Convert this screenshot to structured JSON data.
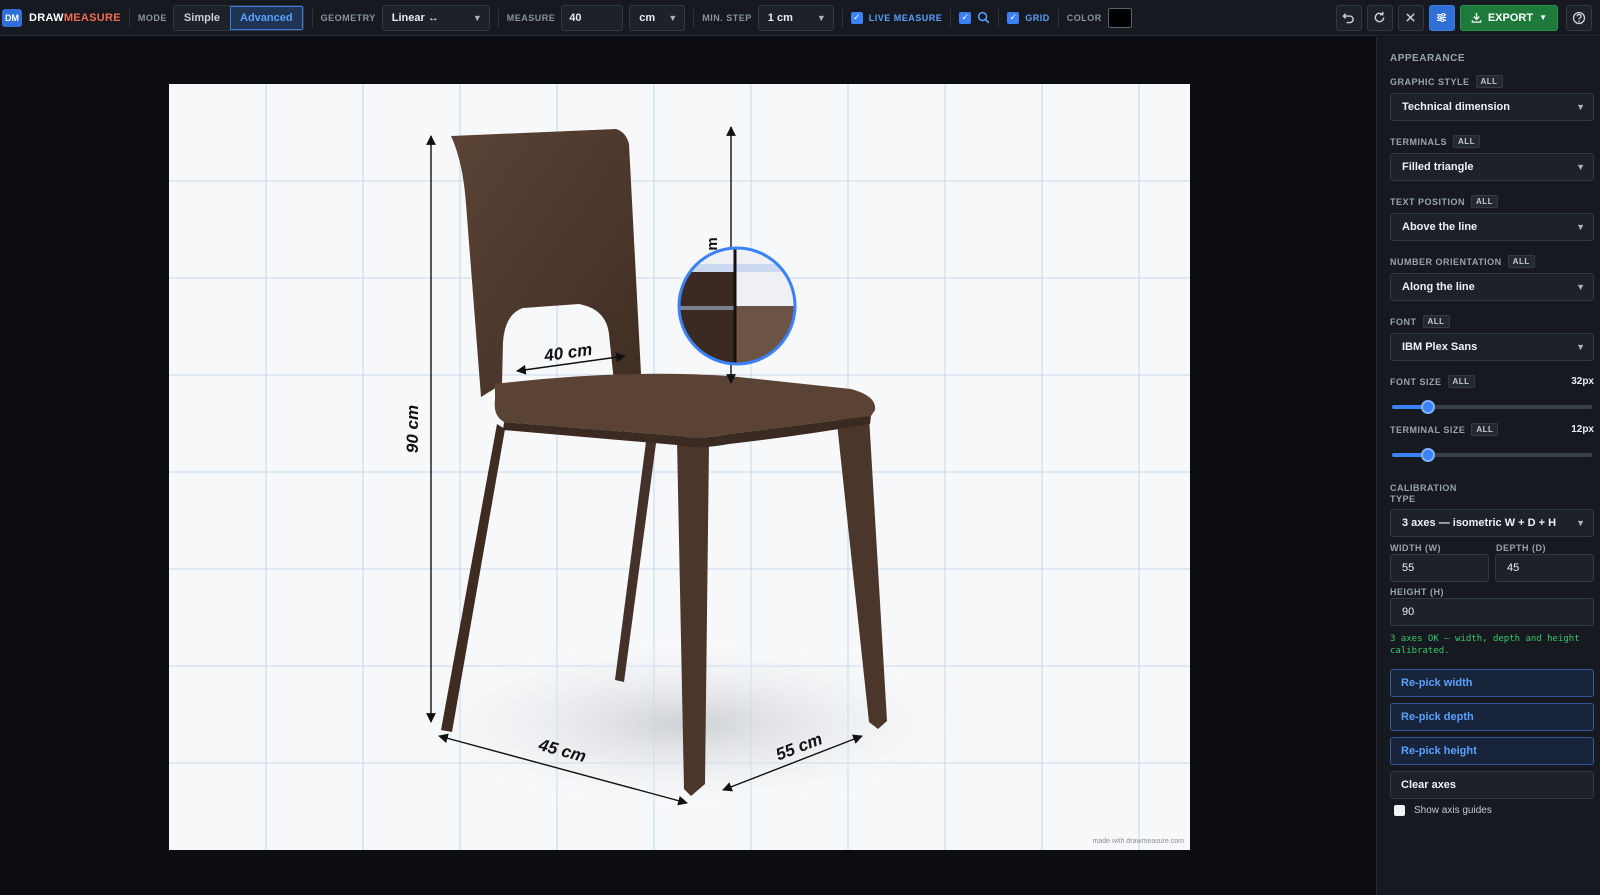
{
  "app": {
    "logo_badge": "DM",
    "name_part1": "DRAW",
    "name_part2": "MEASURE"
  },
  "toolbar": {
    "mode_label": "MODE",
    "mode_options": [
      "Simple",
      "Advanced"
    ],
    "mode_selected": "Advanced",
    "geometry_label": "GEOMETRY",
    "geometry_value": "Linear ↔",
    "measure_label": "MEASURE",
    "measure_value": "40",
    "unit_value": "cm",
    "min_step_label": "MIN. STEP",
    "min_step_value": "1 cm",
    "live_measure_label": "LIVE MEASURE",
    "grid_label": "GRID",
    "color_label": "COLOR",
    "color_value": "#000000",
    "export_label": "EXPORT"
  },
  "canvas": {
    "dimensions": [
      "90 cm",
      "40 cm",
      "45 cm",
      "55 cm"
    ],
    "magnifier_text": "m",
    "watermark": "made with drawmeasure.com"
  },
  "panel": {
    "title": "APPEARANCE",
    "all_label": "ALL",
    "graphic_style_label": "GRAPHIC STYLE",
    "graphic_style_value": "Technical dimension",
    "terminals_label": "TERMINALS",
    "terminals_value": "Filled triangle",
    "text_position_label": "TEXT POSITION",
    "text_position_value": "Above the line",
    "number_orientation_label": "NUMBER ORIENTATION",
    "number_orientation_value": "Along the line",
    "font_label": "FONT",
    "font_value": "IBM Plex Sans",
    "font_size_label": "FONT SIZE",
    "font_size_value": "32px",
    "font_size_fraction": 0.18,
    "terminal_size_label": "TERMINAL SIZE",
    "terminal_size_value": "12px",
    "terminal_size_fraction": 0.18,
    "calibration_type_label": "CALIBRATION TYPE",
    "calibration_type_value": "3 axes — isometric W + D + H",
    "width_label": "WIDTH (W)",
    "width_value": "55",
    "depth_label": "DEPTH (D)",
    "depth_value": "45",
    "height_label": "HEIGHT (H)",
    "height_value": "90",
    "ok_message": "3 axes OK — width, depth and height calibrated.",
    "repick_width": "Re-pick width",
    "repick_depth": "Re-pick depth",
    "repick_height": "Re-pick height",
    "clear_axes": "Clear axes",
    "show_axis_guides": "Show axis guides"
  },
  "colors": {
    "accent_blue": "#3b82f6",
    "export_green": "#1d7a3b",
    "ok_green": "#35c86a",
    "logo_orange": "#ef6b4f",
    "chair_wood": "#4f3a2e"
  }
}
